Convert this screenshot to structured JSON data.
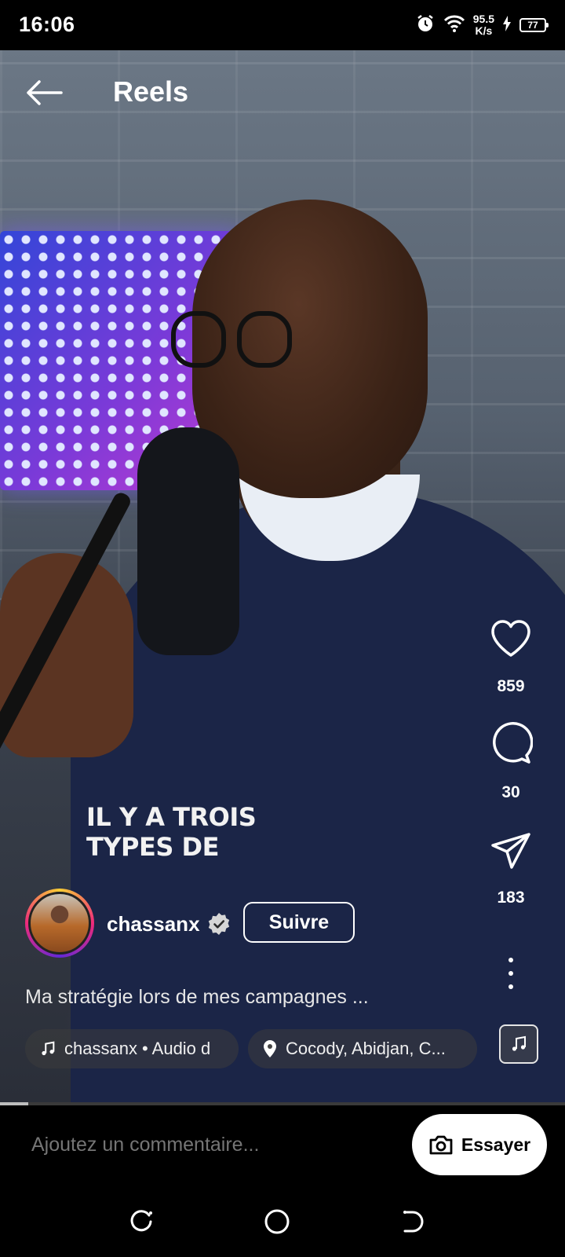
{
  "status_bar": {
    "time": "16:06",
    "net_speed_value": "95.5",
    "net_speed_unit": "K/s",
    "battery": "77",
    "icons": [
      "alarm-icon",
      "wifi-icon",
      "charging-icon",
      "battery-icon"
    ]
  },
  "header": {
    "title": "Reels",
    "back_icon": "arrow-left-icon"
  },
  "video": {
    "overlay_line1": "IL Y A TROIS",
    "overlay_line2": "TYPES DE",
    "progress_percent": 5
  },
  "actions": {
    "like_count": "859",
    "comment_count": "30",
    "share_count": "183",
    "icons": [
      "heart-icon",
      "comment-bubble-icon",
      "send-icon",
      "more-vertical-icon",
      "music-note-icon"
    ]
  },
  "author": {
    "username": "chassanx",
    "verified": true,
    "follow_label": "Suivre"
  },
  "caption": "Ma stratégie lors de mes campagnes ...",
  "chips": {
    "audio": "chassanx • Audio d",
    "location": "Cocody, Abidjan, C..."
  },
  "comment_bar": {
    "placeholder": "Ajoutez un commentaire...",
    "try_label": "Essayer"
  },
  "colors": {
    "background": "#000000",
    "text": "#ffffff",
    "muted_text": "#9a9a9a",
    "chip_bg": "#3c3c3c"
  }
}
